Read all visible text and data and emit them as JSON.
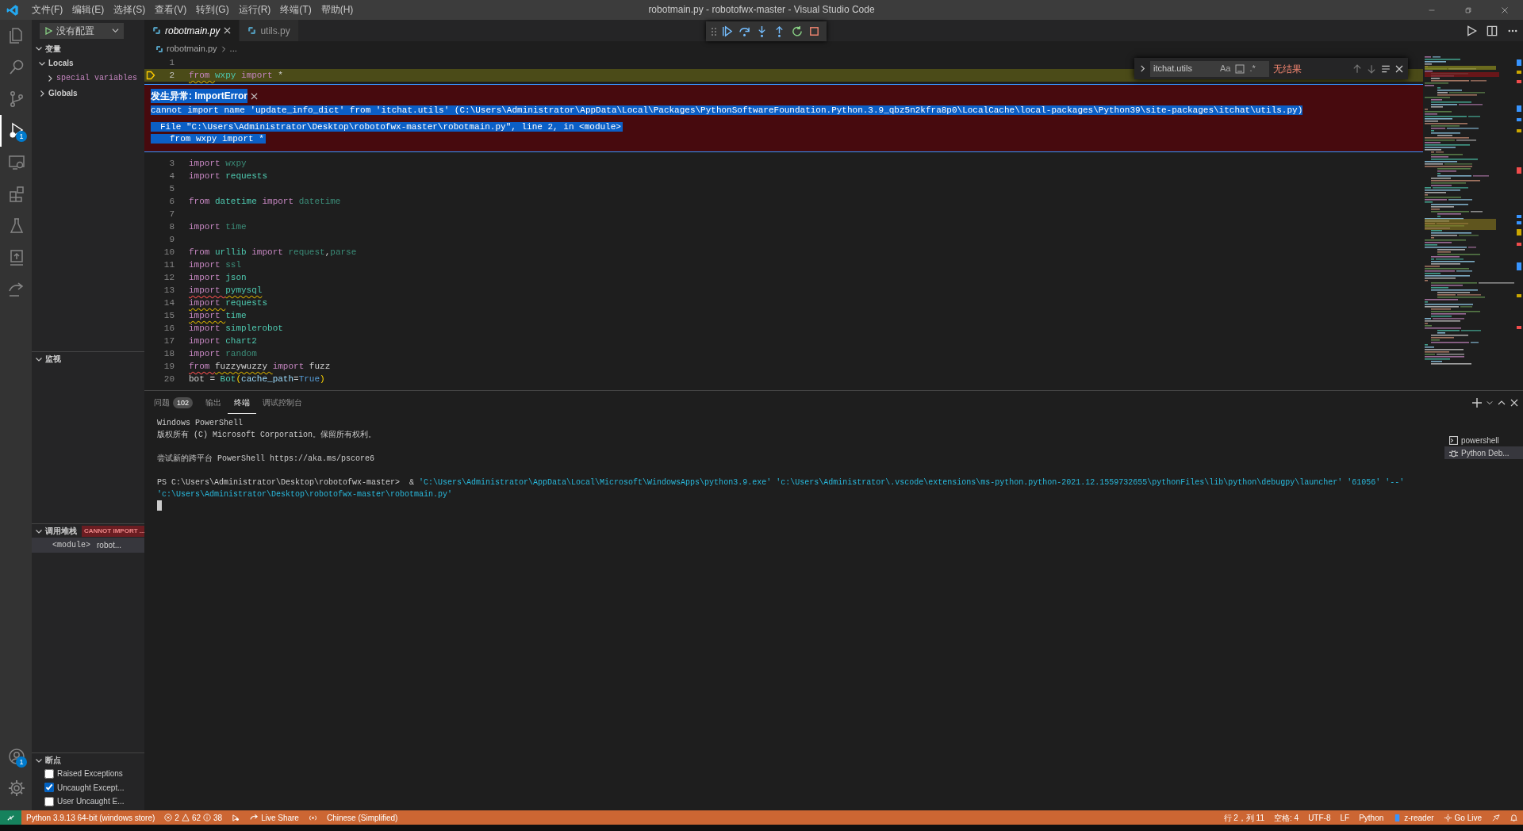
{
  "title_bar": {
    "menus": [
      "文件(F)",
      "编辑(E)",
      "选择(S)",
      "查看(V)",
      "转到(G)",
      "运行(R)",
      "终端(T)",
      "帮助(H)"
    ],
    "title": "robotmain.py - robotofwx-master - Visual Studio Code"
  },
  "activity_bar": {
    "items": [
      {
        "kind": "explorer",
        "selected": false
      },
      {
        "kind": "search",
        "selected": false
      },
      {
        "kind": "scm",
        "selected": false
      },
      {
        "kind": "debug",
        "selected": true,
        "badge": "1"
      },
      {
        "kind": "remote",
        "selected": false
      },
      {
        "kind": "extensions",
        "selected": false
      },
      {
        "kind": "testing",
        "selected": false
      },
      {
        "kind": "upload",
        "selected": false
      },
      {
        "kind": "liveshare",
        "selected": false
      }
    ],
    "bottom": [
      {
        "kind": "account",
        "badge": "1"
      },
      {
        "kind": "settings"
      }
    ]
  },
  "sidebar": {
    "run_config": "没有配置",
    "variables": {
      "title": "变量",
      "expanded": true,
      "tree": [
        {
          "label": "Locals",
          "expanded": true,
          "children": [
            {
              "label": "special variables",
              "expanded": false
            }
          ]
        },
        {
          "label": "Globals",
          "expanded": false
        }
      ]
    },
    "watch": {
      "title": "监视",
      "expanded": true
    },
    "call_stack": {
      "title": "调用堆栈",
      "expanded": true,
      "status": "CANNOT IMPORT ...",
      "frames": [
        {
          "name": "<module>",
          "file": "robot..."
        }
      ]
    },
    "breakpoints": {
      "title": "断点",
      "expanded": true,
      "items": [
        {
          "label": "Raised Exceptions",
          "checked": false
        },
        {
          "label": "Uncaught Except...",
          "checked": true
        },
        {
          "label": "User Uncaught E...",
          "checked": false
        }
      ]
    }
  },
  "editor": {
    "tabs": [
      {
        "label": "robotmain.py",
        "selected": true,
        "preview": true
      },
      {
        "label": "utils.py",
        "selected": false,
        "preview": false
      }
    ],
    "breadcrumb": [
      "robotmain.py",
      "..."
    ],
    "debug_toolbar": [
      {
        "kind": "continue"
      },
      {
        "kind": "step_over"
      },
      {
        "kind": "step_into"
      },
      {
        "kind": "step_out"
      },
      {
        "kind": "restart"
      },
      {
        "kind": "stop"
      }
    ],
    "find": {
      "value": "itchat.utils",
      "result": "无结果",
      "case_label": "Aa",
      "regex_label": ".*"
    },
    "lines": [
      {
        "kind": "code",
        "number": "1",
        "current": false
      },
      {
        "kind": "code",
        "number": "2",
        "current": true,
        "tokens": [
          {
            "text": "from",
            "kind": "kw",
            "warning": true,
            "space": true
          },
          {
            "text": "wxpy",
            "kind": "mod",
            "space": true
          },
          {
            "text": "import",
            "kind": "kw",
            "space": true
          },
          {
            "text": "*",
            "kind": "plain"
          }
        ]
      },
      {
        "kind": "exception",
        "title": "发生异常: ImportError",
        "message": "cannot import name 'update_info_dict' from 'itchat.utils' (C:\\Users\\Administrator\\AppData\\Local\\Packages\\PythonSoftwareFoundation.Python.3.9_qbz5n2kfra8p0\\LocalCache\\local-packages\\Python39\\site-packages\\itchat\\utils.py)",
        "traceback": [
          "File \"C:\\Users\\Administrator\\Desktop\\robotofwx-master\\robotmain.py\", line 2, in <module>",
          "from wxpy import *"
        ]
      },
      {
        "kind": "code",
        "number": "3",
        "current": false,
        "tokens": [
          {
            "text": "import",
            "kind": "kw",
            "space": true
          },
          {
            "text": "wxpy",
            "kind": "dim"
          }
        ]
      },
      {
        "kind": "code",
        "number": "4",
        "current": false,
        "tokens": [
          {
            "text": "import",
            "kind": "kw",
            "space": true
          },
          {
            "text": "requests",
            "kind": "mod"
          }
        ]
      },
      {
        "kind": "code",
        "number": "5",
        "current": false
      },
      {
        "kind": "code",
        "number": "6",
        "current": false,
        "tokens": [
          {
            "text": "from",
            "kind": "kw",
            "space": true
          },
          {
            "text": "datetime",
            "kind": "mod",
            "space": true
          },
          {
            "text": "import",
            "kind": "kw",
            "space": true
          },
          {
            "text": "datetime",
            "kind": "dim"
          }
        ]
      },
      {
        "kind": "code",
        "number": "7",
        "current": false
      },
      {
        "kind": "code",
        "number": "8",
        "current": false,
        "tokens": [
          {
            "text": "import",
            "kind": "kw",
            "space": true
          },
          {
            "text": "time",
            "kind": "dim"
          }
        ]
      },
      {
        "kind": "code",
        "number": "9",
        "current": false
      },
      {
        "kind": "code",
        "number": "10",
        "current": false,
        "tokens": [
          {
            "text": "from",
            "kind": "kw",
            "space": true
          },
          {
            "text": "urllib",
            "kind": "mod",
            "space": true
          },
          {
            "text": "import",
            "kind": "kw",
            "space": true
          },
          {
            "text": "request",
            "kind": "dim"
          },
          {
            "text": ",",
            "kind": "plain"
          },
          {
            "text": "parse",
            "kind": "dim"
          }
        ]
      },
      {
        "kind": "code",
        "number": "11",
        "current": false,
        "tokens": [
          {
            "text": "import",
            "kind": "kw",
            "space": true
          },
          {
            "text": "ssl",
            "kind": "dim"
          }
        ]
      },
      {
        "kind": "code",
        "number": "12",
        "current": false,
        "tokens": [
          {
            "text": "import",
            "kind": "kw",
            "space": true
          },
          {
            "text": "json",
            "kind": "mod"
          }
        ]
      },
      {
        "kind": "code",
        "number": "13",
        "current": false,
        "tokens": [
          {
            "text": "import",
            "kind": "kw",
            "error": true,
            "space": true
          },
          {
            "text": "pymysql",
            "kind": "mod",
            "warning": true
          }
        ]
      },
      {
        "kind": "code",
        "number": "14",
        "current": false,
        "tokens": [
          {
            "text": "import",
            "kind": "kw",
            "warning": true,
            "space": true
          },
          {
            "text": "requests",
            "kind": "mod"
          }
        ]
      },
      {
        "kind": "code",
        "number": "15",
        "current": false,
        "tokens": [
          {
            "text": "import",
            "kind": "kw",
            "warning": true,
            "space": true
          },
          {
            "text": "time",
            "kind": "mod"
          }
        ]
      },
      {
        "kind": "code",
        "number": "16",
        "current": false,
        "tokens": [
          {
            "text": "import",
            "kind": "kw",
            "space": true
          },
          {
            "text": "simplerobot",
            "kind": "mod"
          }
        ]
      },
      {
        "kind": "code",
        "number": "17",
        "current": false,
        "tokens": [
          {
            "text": "import",
            "kind": "kw",
            "space": true
          },
          {
            "text": "chart2",
            "kind": "mod"
          }
        ]
      },
      {
        "kind": "code",
        "number": "18",
        "current": false,
        "tokens": [
          {
            "text": "import",
            "kind": "kw",
            "space": true
          },
          {
            "text": "random",
            "kind": "dim"
          }
        ]
      },
      {
        "kind": "code",
        "number": "19",
        "current": false,
        "tokens": [
          {
            "text": "from",
            "kind": "kw",
            "error": true,
            "space": true
          },
          {
            "text": "fuzzywuzzy",
            "kind": "plain",
            "warning": true,
            "space": true
          },
          {
            "text": "import",
            "kind": "kw",
            "space": true
          },
          {
            "text": "fuzz",
            "kind": "plain"
          }
        ]
      },
      {
        "kind": "code",
        "number": "20",
        "current": false,
        "tokens": [
          {
            "text": "bot",
            "kind": "plain",
            "space": true
          },
          {
            "text": "=",
            "kind": "plain",
            "space": true
          },
          {
            "text": "Bot",
            "kind": "cls"
          },
          {
            "text": "(",
            "kind": "paren"
          },
          {
            "text": "cache_path",
            "kind": "var"
          },
          {
            "text": "=",
            "kind": "plain"
          },
          {
            "text": "True",
            "kind": "const"
          },
          {
            "text": ")",
            "kind": "paren"
          }
        ]
      }
    ]
  },
  "panel": {
    "tabs": [
      {
        "label": "问题",
        "badge": "102",
        "selected": false
      },
      {
        "label": "输出",
        "selected": false
      },
      {
        "label": "终端",
        "selected": true
      },
      {
        "label": "调试控制台",
        "selected": false
      }
    ],
    "terminal": [
      {
        "kind": "text",
        "text": "Windows PowerShell"
      },
      {
        "kind": "text",
        "text": "版权所有 (C) Microsoft Corporation。保留所有权利。"
      },
      {
        "kind": "blank"
      },
      {
        "kind": "text",
        "text": "尝试新的跨平台 PowerShell https://aka.ms/pscore6"
      },
      {
        "kind": "blank"
      },
      {
        "kind": "command",
        "prompt": "PS C:\\Users\\Administrator\\Desktop\\robotofwx-master>",
        "operator": "&",
        "args": "'C:\\Users\\Administrator\\AppData\\Local\\Microsoft\\WindowsApps\\python3.9.exe' 'c:\\Users\\Administrator\\.vscode\\extensions\\ms-python.python-2021.12.1559732655\\pythonFiles\\lib\\python\\debugpy\\launcher' '61056' '--' 'c:\\Users\\Administrator\\Desktop\\robotofwx-master\\robotmain.py'"
      },
      {
        "kind": "cursor"
      }
    ],
    "terminals": [
      {
        "label": "powershell",
        "kind": "shell",
        "selected": false
      },
      {
        "label": "Python Deb...",
        "kind": "debug",
        "selected": true
      }
    ]
  },
  "status_bar": {
    "left": [
      {
        "kind": "remote"
      },
      {
        "kind": "interpreter",
        "text": "Python 3.9.13 64-bit (windows store)"
      },
      {
        "kind": "problems",
        "errors": "2",
        "warnings": "62",
        "infos": "38"
      },
      {
        "kind": "debug"
      },
      {
        "kind": "liveshare",
        "text": "Live Share"
      },
      {
        "kind": "broadcast"
      },
      {
        "kind": "language_pack",
        "text": "Chinese (Simplified)"
      }
    ],
    "right": [
      {
        "kind": "cursor",
        "text": "行 2，列 11"
      },
      {
        "kind": "indent",
        "text": "空格: 4"
      },
      {
        "kind": "encoding",
        "text": "UTF-8"
      },
      {
        "kind": "eol",
        "text": "LF"
      },
      {
        "kind": "mode",
        "text": "Python"
      },
      {
        "kind": "zreader",
        "text": "z-reader"
      },
      {
        "kind": "golive",
        "text": "Go Live"
      },
      {
        "kind": "feedback"
      },
      {
        "kind": "notifications"
      }
    ]
  }
}
